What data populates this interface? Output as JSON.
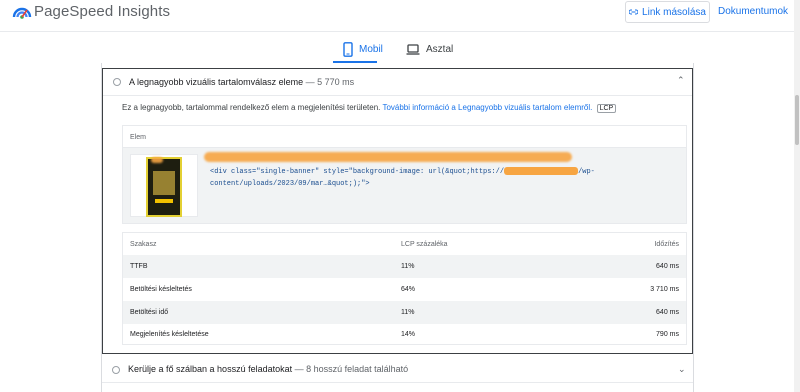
{
  "header": {
    "brand": "PageSpeed Insights",
    "copy_link_label": "Link másolása",
    "docs_label": "Dokumentumok",
    "accent_color": "#1a73e8"
  },
  "tabs": [
    {
      "label": "Mobil",
      "icon": "phone-icon",
      "active": true
    },
    {
      "label": "Asztal",
      "icon": "laptop-icon",
      "active": false
    }
  ],
  "audit": {
    "title": "A legnagyobb vizuális tartalomválasz eleme",
    "value": " — 5 770 ms",
    "description": "Ez a legnagyobb, tartalommal rendelkező elem a megjelenítési területen.",
    "link": "További információ a Legnagyobb vizuális tartalom elemről.",
    "badge": "LCP",
    "element_header": "Elem",
    "code_line1": "<div class=\"single-banner\" style=\"background-image: url(&quot;https://",
    "code_line1_end": "/wp-",
    "code_line2": "content/uploads/2023/09/mar…&quot;);\">"
  },
  "phase_table": {
    "headers": [
      "Szakasz",
      "LCP százaléka",
      "Időzítés"
    ],
    "rows": [
      {
        "phase": "TTFB",
        "percent": "11%",
        "timing": "640 ms"
      },
      {
        "phase": "Betöltési késleltetés",
        "percent": "64%",
        "timing": "3 710 ms"
      },
      {
        "phase": "Betöltési idő",
        "percent": "11%",
        "timing": "640 ms"
      },
      {
        "phase": "Megjelenítés késleltetése",
        "percent": "14%",
        "timing": "790 ms"
      }
    ]
  },
  "next_audit": {
    "title": "Kerülje a fő szálban a hosszú feladatokat",
    "value": " — 8 hosszú feladat található"
  }
}
